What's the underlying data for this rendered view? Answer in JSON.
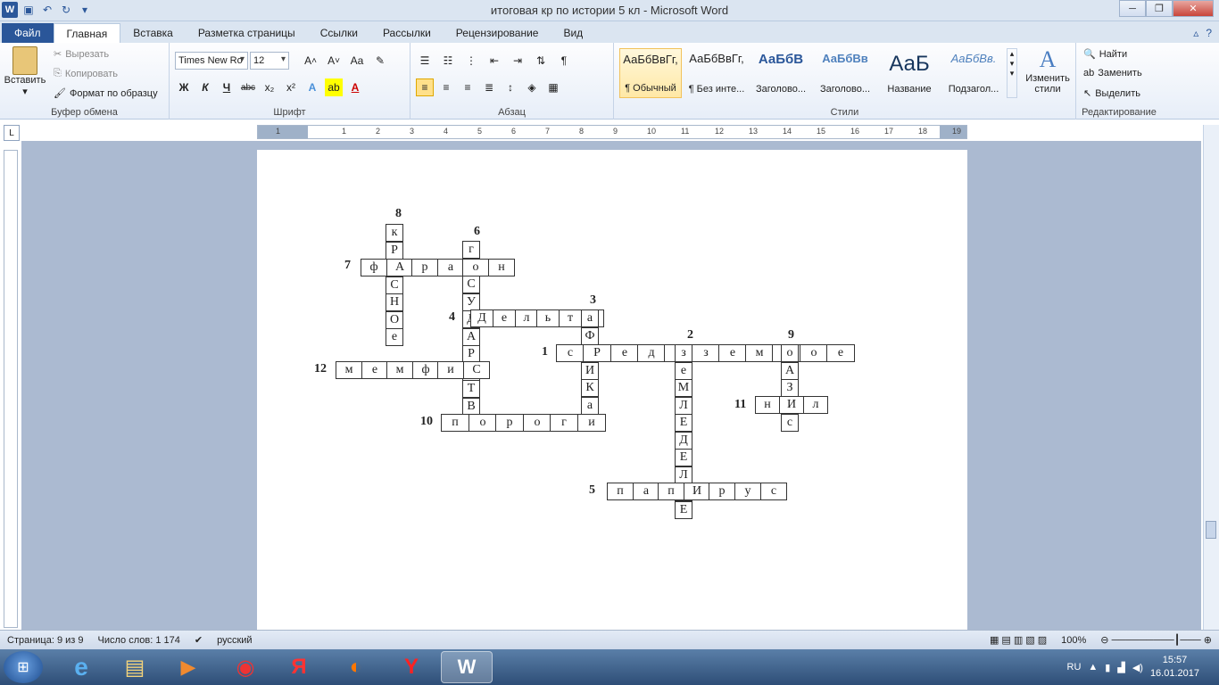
{
  "window": {
    "title": "итоговая кр по истории 5 кл  -  Microsoft Word",
    "min": "─",
    "max": "❐",
    "close": "✕"
  },
  "tabs": [
    "Главная",
    "Вставка",
    "Разметка страницы",
    "Ссылки",
    "Рассылки",
    "Рецензирование",
    "Вид"
  ],
  "file_tab": "Файл",
  "ribbon": {
    "clipboard": {
      "paste": "Вставить",
      "cut": "Вырезать",
      "copy": "Копировать",
      "format": "Формат по образцу",
      "label": "Буфер обмена"
    },
    "font": {
      "family": "Times New Ro",
      "size": "12",
      "label": "Шрифт",
      "bold": "Ж",
      "italic": "К",
      "underline": "Ч",
      "strike": "abc",
      "sub": "x₂",
      "sup": "x²"
    },
    "paragraph": {
      "label": "Абзац"
    },
    "styles": {
      "label": "Стили",
      "items": [
        {
          "sample": "АаБбВвГг,",
          "name": "¶ Обычный"
        },
        {
          "sample": "АаБбВвГг,",
          "name": "¶ Без инте..."
        },
        {
          "sample": "АаБбВ",
          "name": "Заголово..."
        },
        {
          "sample": "АаБбВв",
          "name": "Заголово..."
        },
        {
          "sample": "АаБ",
          "name": "Название"
        },
        {
          "sample": "АаБбВв.",
          "name": "Подзагол..."
        }
      ],
      "change": "Изменить стили"
    },
    "editing": {
      "label": "Редактирование",
      "find": "Найти",
      "replace": "Заменить",
      "select": "Выделить"
    }
  },
  "ruler_numbers": [
    "1",
    "1",
    "2",
    "3",
    "4",
    "5",
    "6",
    "7",
    "8",
    "9",
    "10",
    "11",
    "12",
    "13",
    "14",
    "15",
    "16",
    "17",
    "18",
    "19"
  ],
  "crossword": {
    "numbers": [
      {
        "id": "8",
        "t": "8"
      },
      {
        "id": "6",
        "t": "6"
      },
      {
        "id": "7",
        "t": "7"
      },
      {
        "id": "3",
        "t": "3"
      },
      {
        "id": "4",
        "t": "4"
      },
      {
        "id": "2",
        "t": "2"
      },
      {
        "id": "9",
        "t": "9"
      },
      {
        "id": "1",
        "t": "1"
      },
      {
        "id": "12",
        "t": "12"
      },
      {
        "id": "11",
        "t": "11"
      },
      {
        "id": "10",
        "t": "10"
      },
      {
        "id": "5",
        "t": "5"
      }
    ],
    "words": {
      "w8": [
        "к",
        "Р",
        "А",
        "С",
        "Н",
        "О",
        "е"
      ],
      "w6": [
        "г",
        "о",
        "С",
        "У",
        "Д",
        "А",
        "Р",
        "С",
        "Т",
        "В"
      ],
      "w7": [
        "ф",
        "А",
        "р",
        "а",
        "о",
        "н"
      ],
      "w4": [
        "Д",
        "е",
        "л",
        "ь",
        "т",
        "а"
      ],
      "w3": [
        "а",
        "Ф",
        "Р",
        "И",
        "К",
        "а"
      ],
      "w1": [
        "с",
        "Р",
        "е",
        "д",
        "и",
        "з",
        "е",
        "м",
        "н",
        "о",
        "е"
      ],
      "w2": [
        "з",
        "е",
        "М",
        "Л",
        "Е",
        "Д",
        "Е",
        "Л",
        "И",
        "Е"
      ],
      "w9": [
        "о",
        "А",
        "З",
        "И",
        "с"
      ],
      "w12": [
        "м",
        "е",
        "м",
        "ф",
        "и",
        "С"
      ],
      "w11": [
        "н",
        "И",
        "л"
      ],
      "w10": [
        "п",
        "о",
        "р",
        "о",
        "г",
        "и"
      ],
      "w5": [
        "п",
        "а",
        "п",
        "И",
        "р",
        "у",
        "с"
      ]
    }
  },
  "status": {
    "page": "Страница: 9 из 9",
    "words": "Число слов: 1 174",
    "lang": "русский",
    "zoom": "100%"
  },
  "taskbar": {
    "lang": "RU",
    "time": "15:57",
    "date": "16.01.2017"
  }
}
